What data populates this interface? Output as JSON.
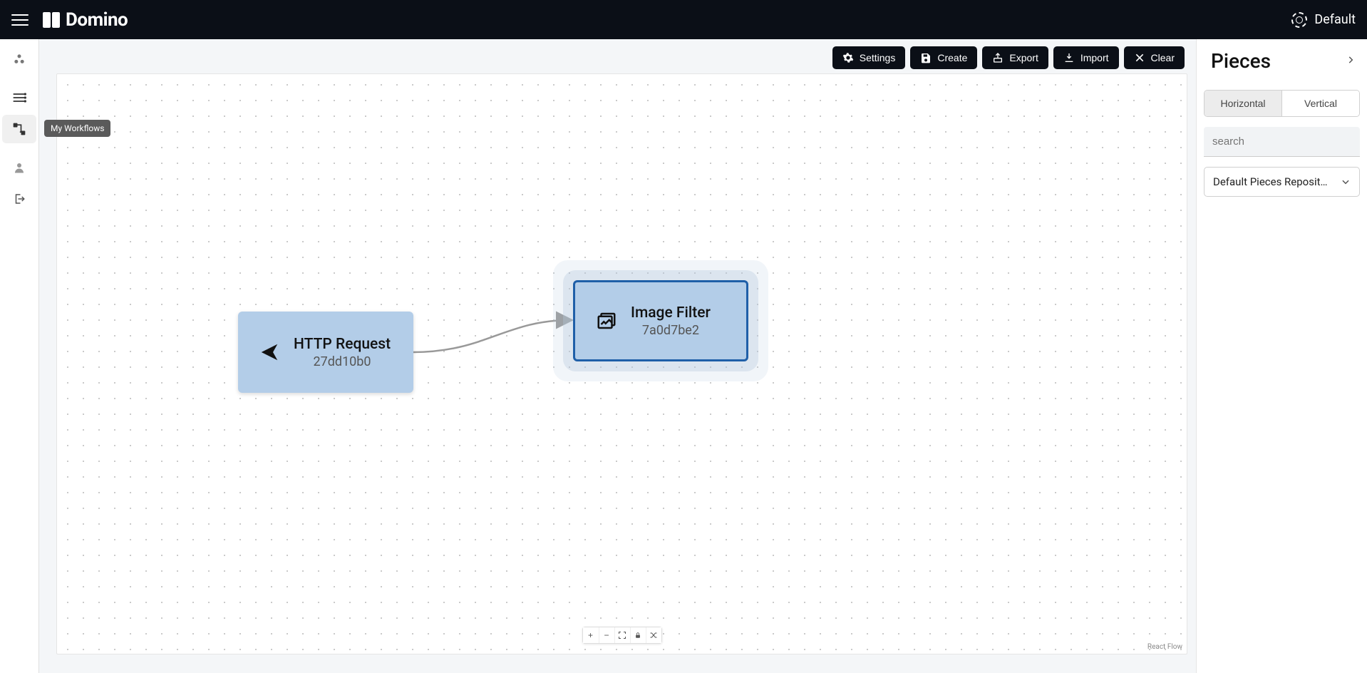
{
  "header": {
    "brand": "Domino",
    "workspace": "Default"
  },
  "sidebar": {
    "tooltip": "My Workflows"
  },
  "toolbar": {
    "settings": "Settings",
    "create": "Create",
    "export": "Export",
    "import": "Import",
    "clear": "Clear"
  },
  "canvas": {
    "attribution": "React Flow",
    "nodes": {
      "http": {
        "title": "HTTP Request",
        "id": "27dd10b0"
      },
      "filter": {
        "title": "Image Filter",
        "id": "7a0d7be2"
      }
    }
  },
  "panel": {
    "title": "Pieces",
    "tabs": {
      "horizontal": "Horizontal",
      "vertical": "Vertical"
    },
    "search_placeholder": "search",
    "repo": "Default Pieces Reposit…"
  }
}
